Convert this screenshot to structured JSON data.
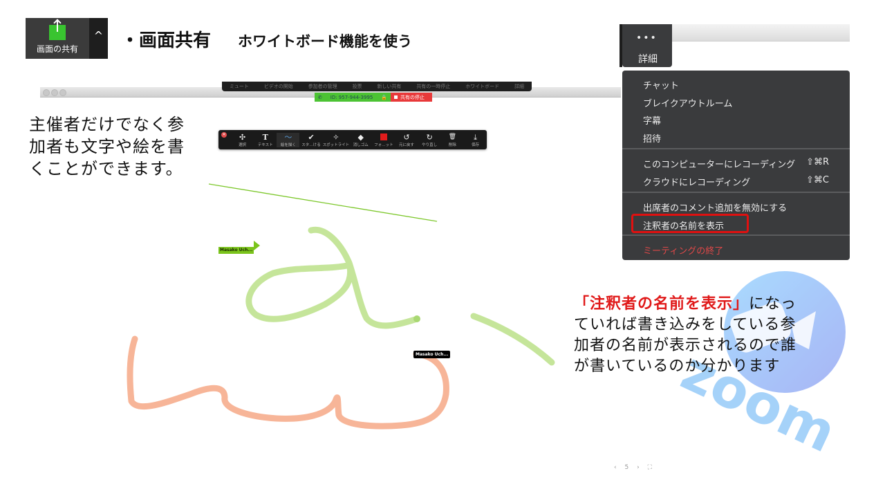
{
  "header": {
    "share_button_label": "画面の共有",
    "share_caret_icon": "caret-up-icon",
    "title_main": "・画面共有",
    "title_sub": "ホワイトボード機能を使う"
  },
  "meeting_toolbar": {
    "items": [
      "ミュート",
      "ビデオの開始",
      "参加者の管理",
      "投票",
      "新しい共有",
      "共有の一時停止",
      "ホワイトボード",
      "詳細"
    ]
  },
  "share_bar": {
    "meeting_id": "ID: 957-944-3995",
    "stop_label": "共有の停止"
  },
  "annotation_toolbar": {
    "tools": [
      {
        "icon": "move-icon",
        "glyph": "✣",
        "label": "選択"
      },
      {
        "icon": "text-icon",
        "glyph": "T",
        "label": "テキスト"
      },
      {
        "icon": "draw-icon",
        "glyph": "〜",
        "label": "絵を描く",
        "active": true
      },
      {
        "icon": "stamp-icon",
        "glyph": "✔",
        "label": "スタ…ける"
      },
      {
        "icon": "spotlight-icon",
        "glyph": "✧",
        "label": "スポットライト"
      },
      {
        "icon": "eraser-icon",
        "glyph": "◆",
        "label": "消しゴム"
      },
      {
        "icon": "format-icon",
        "glyph": "",
        "label": "フォ…ット"
      },
      {
        "icon": "undo-icon",
        "glyph": "↺",
        "label": "元に戻す"
      },
      {
        "icon": "redo-icon",
        "glyph": "↻",
        "label": "やり直し"
      },
      {
        "icon": "trash-icon",
        "glyph": "🗑",
        "label": "削除"
      },
      {
        "icon": "save-icon",
        "glyph": "⤓",
        "label": "保存"
      }
    ],
    "format_color": "#e21c1c"
  },
  "left_text": "主催者だけでなく参加者も文字や絵を書くことができます。",
  "annotator_tags": [
    "Masako Uch...",
    "Masako Uch..."
  ],
  "more_menu": {
    "button_label": "詳細",
    "dots": "•••",
    "groups": [
      [
        {
          "label": "チャット"
        },
        {
          "label": "ブレイクアウトルーム"
        },
        {
          "label": "字幕"
        },
        {
          "label": "招待"
        }
      ],
      [
        {
          "label": "このコンピューターにレコーディング",
          "shortcut": "⇧⌘R"
        },
        {
          "label": "クラウドにレコーディング",
          "shortcut": "⇧⌘C"
        }
      ],
      [
        {
          "label": "出席者のコメント追加を無効にする"
        },
        {
          "label": "注釈者の名前を表示",
          "highlighted": true
        }
      ],
      [
        {
          "label": "ミーティングの終了",
          "danger": true
        }
      ]
    ]
  },
  "right_text": {
    "highlight": "「注釈者の名前を表示」",
    "rest": "になっていれば書き込みをしている参加者の名前が表示されるので誰が書いているのか分かります"
  },
  "page_nav": {
    "prev": "‹",
    "page": "5",
    "next": "›"
  },
  "colors": {
    "green_stroke": "#c5e59a",
    "orange_stroke": "#f7b598",
    "line_stroke": "#7cc72a",
    "zoom_blue": "#78b6f5"
  }
}
